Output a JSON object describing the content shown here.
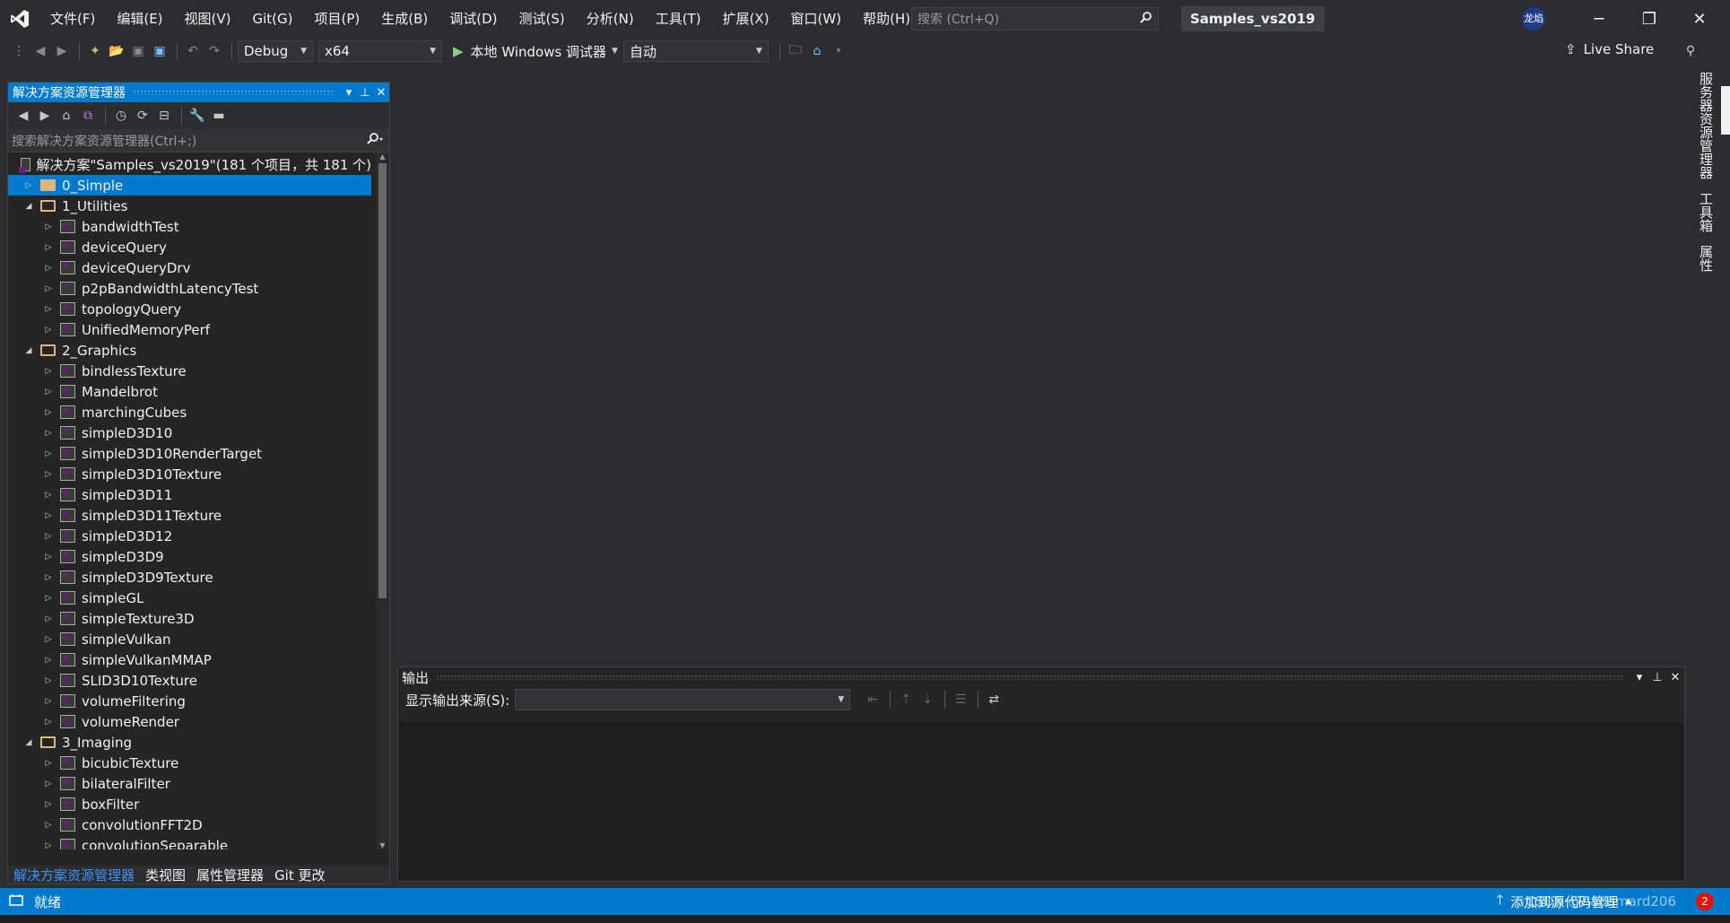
{
  "app": {
    "menu": [
      "文件(F)",
      "编辑(E)",
      "视图(V)",
      "Git(G)",
      "项目(P)",
      "生成(B)",
      "调试(D)",
      "测试(S)",
      "分析(N)",
      "工具(T)",
      "扩展(X)",
      "窗口(W)",
      "帮助(H)"
    ],
    "search_placeholder": "搜索 (Ctrl+Q)",
    "solution_title": "Samples_vs2019",
    "user_initials": "龙焰",
    "accent_color": "#007acc"
  },
  "toolbar": {
    "config": "Debug",
    "platform": "x64",
    "run_label": "本地 Windows 调试器",
    "run_mode": "自动",
    "live_share": "Live Share"
  },
  "solution_explorer": {
    "title": "解决方案资源管理器",
    "search_placeholder": "搜索解决方案资源管理器(Ctrl+;)",
    "solution_node": "解决方案\"Samples_vs2019\"(181 个项目，共 181 个)",
    "tree": [
      {
        "label": "0_Simple",
        "level": 1,
        "type": "folder",
        "expanded": false,
        "selected": true
      },
      {
        "label": "1_Utilities",
        "level": 1,
        "type": "folder",
        "expanded": true
      },
      {
        "label": "bandwidthTest",
        "level": 2,
        "type": "project"
      },
      {
        "label": "deviceQuery",
        "level": 2,
        "type": "project"
      },
      {
        "label": "deviceQueryDrv",
        "level": 2,
        "type": "project"
      },
      {
        "label": "p2pBandwidthLatencyTest",
        "level": 2,
        "type": "project"
      },
      {
        "label": "topologyQuery",
        "level": 2,
        "type": "project"
      },
      {
        "label": "UnifiedMemoryPerf",
        "level": 2,
        "type": "project"
      },
      {
        "label": "2_Graphics",
        "level": 1,
        "type": "folder",
        "expanded": true
      },
      {
        "label": "bindlessTexture",
        "level": 2,
        "type": "project"
      },
      {
        "label": "Mandelbrot",
        "level": 2,
        "type": "project"
      },
      {
        "label": "marchingCubes",
        "level": 2,
        "type": "project"
      },
      {
        "label": "simpleD3D10",
        "level": 2,
        "type": "project"
      },
      {
        "label": "simpleD3D10RenderTarget",
        "level": 2,
        "type": "project"
      },
      {
        "label": "simpleD3D10Texture",
        "level": 2,
        "type": "project"
      },
      {
        "label": "simpleD3D11",
        "level": 2,
        "type": "project"
      },
      {
        "label": "simpleD3D11Texture",
        "level": 2,
        "type": "project"
      },
      {
        "label": "simpleD3D12",
        "level": 2,
        "type": "project"
      },
      {
        "label": "simpleD3D9",
        "level": 2,
        "type": "project"
      },
      {
        "label": "simpleD3D9Texture",
        "level": 2,
        "type": "project"
      },
      {
        "label": "simpleGL",
        "level": 2,
        "type": "project"
      },
      {
        "label": "simpleTexture3D",
        "level": 2,
        "type": "project"
      },
      {
        "label": "simpleVulkan",
        "level": 2,
        "type": "project"
      },
      {
        "label": "simpleVulkanMMAP",
        "level": 2,
        "type": "project"
      },
      {
        "label": "SLID3D10Texture",
        "level": 2,
        "type": "project"
      },
      {
        "label": "volumeFiltering",
        "level": 2,
        "type": "project"
      },
      {
        "label": "volumeRender",
        "level": 2,
        "type": "project"
      },
      {
        "label": "3_Imaging",
        "level": 1,
        "type": "folder",
        "expanded": true
      },
      {
        "label": "bicubicTexture",
        "level": 2,
        "type": "project"
      },
      {
        "label": "bilateralFilter",
        "level": 2,
        "type": "project"
      },
      {
        "label": "boxFilter",
        "level": 2,
        "type": "project"
      },
      {
        "label": "convolutionFFT2D",
        "level": 2,
        "type": "project"
      },
      {
        "label": "convolutionSeparable",
        "level": 2,
        "type": "project"
      }
    ],
    "bottom_tabs": [
      "解决方案资源管理器",
      "类视图",
      "属性管理器",
      "Git 更改"
    ]
  },
  "output": {
    "title": "输出",
    "source_label": "显示输出来源(S):",
    "source_value": ""
  },
  "right_tabs": [
    "服务器资源管理器",
    "工具箱",
    "属性"
  ],
  "status": {
    "ready": "就绪",
    "source_control": "添加到源代码管理",
    "watermark": "CSDN @hadamard206",
    "notifications": "2"
  }
}
